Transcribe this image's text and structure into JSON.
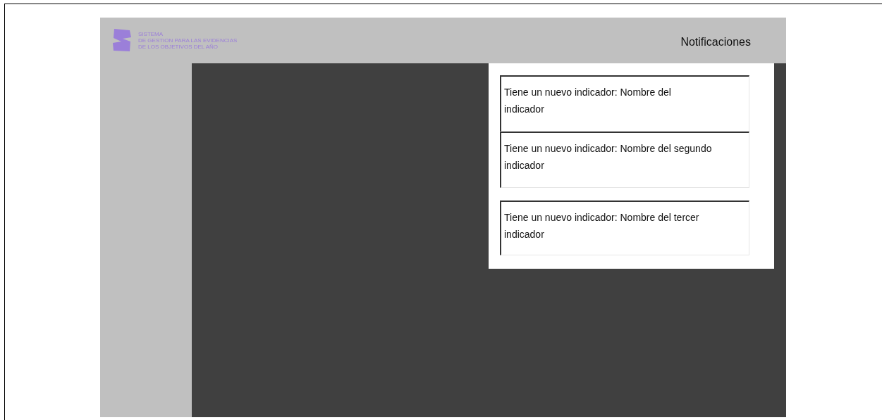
{
  "logo": {
    "lines": [
      "SISTEMA",
      "DE GESTION PARA LAS EVIDENCIAS",
      "DE LOS OBJETIVOS DEL AÑO"
    ]
  },
  "header": {
    "title": "Notificaciones"
  },
  "notifications": [
    {
      "text": "Tiene un nuevo indicador: Nombre del indicador"
    },
    {
      "text": "Tiene un nuevo indicador: Nombre del segundo indicador"
    },
    {
      "text": "Tiene un nuevo indicador: Nombre del tercer indicador"
    }
  ]
}
